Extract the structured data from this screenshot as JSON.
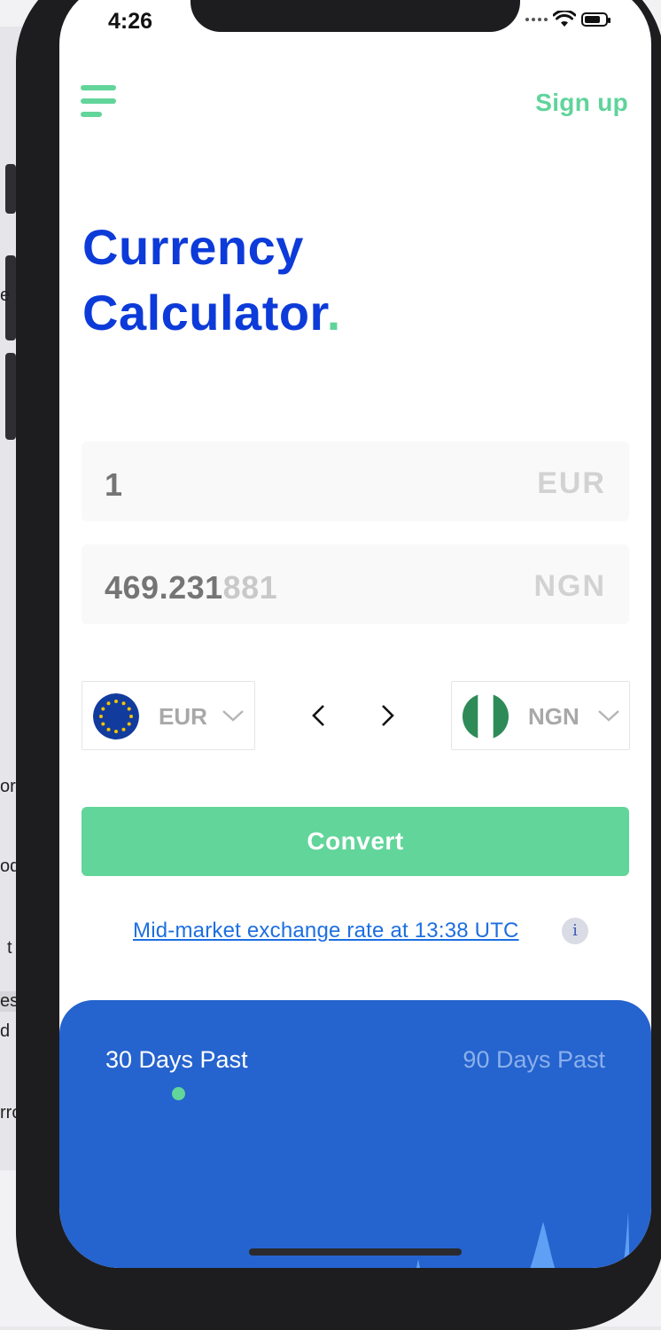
{
  "status_bar": {
    "time": "4:26"
  },
  "header": {
    "signup_label": "Sign up"
  },
  "title": {
    "line1": "Currency",
    "line2": "Calculator",
    "dot": "."
  },
  "from_field": {
    "value": "1",
    "currency": "EUR"
  },
  "to_field": {
    "value_main": "469.231",
    "value_faint": "881",
    "currency": "NGN"
  },
  "from_select": {
    "currency": "EUR",
    "flag": "eu-flag-icon"
  },
  "to_select": {
    "currency": "NGN",
    "flag": "nigeria-flag-icon"
  },
  "convert_label": "Convert",
  "rate_note": "Mid-market exchange rate at 13:38 UTC",
  "info_glyph": "i",
  "history": {
    "tabs": [
      {
        "label": "30 Days Past",
        "active": true
      },
      {
        "label": "90 Days Past",
        "active": false
      }
    ]
  },
  "colors": {
    "brand_blue": "#0d3bd9",
    "accent_green": "#62d59a",
    "panel_blue": "#2563ce",
    "link_blue": "#1d6fe0"
  },
  "background_fragments": [
    "e",
    "orl",
    "od",
    "t",
    "es",
    "d",
    "rro"
  ]
}
